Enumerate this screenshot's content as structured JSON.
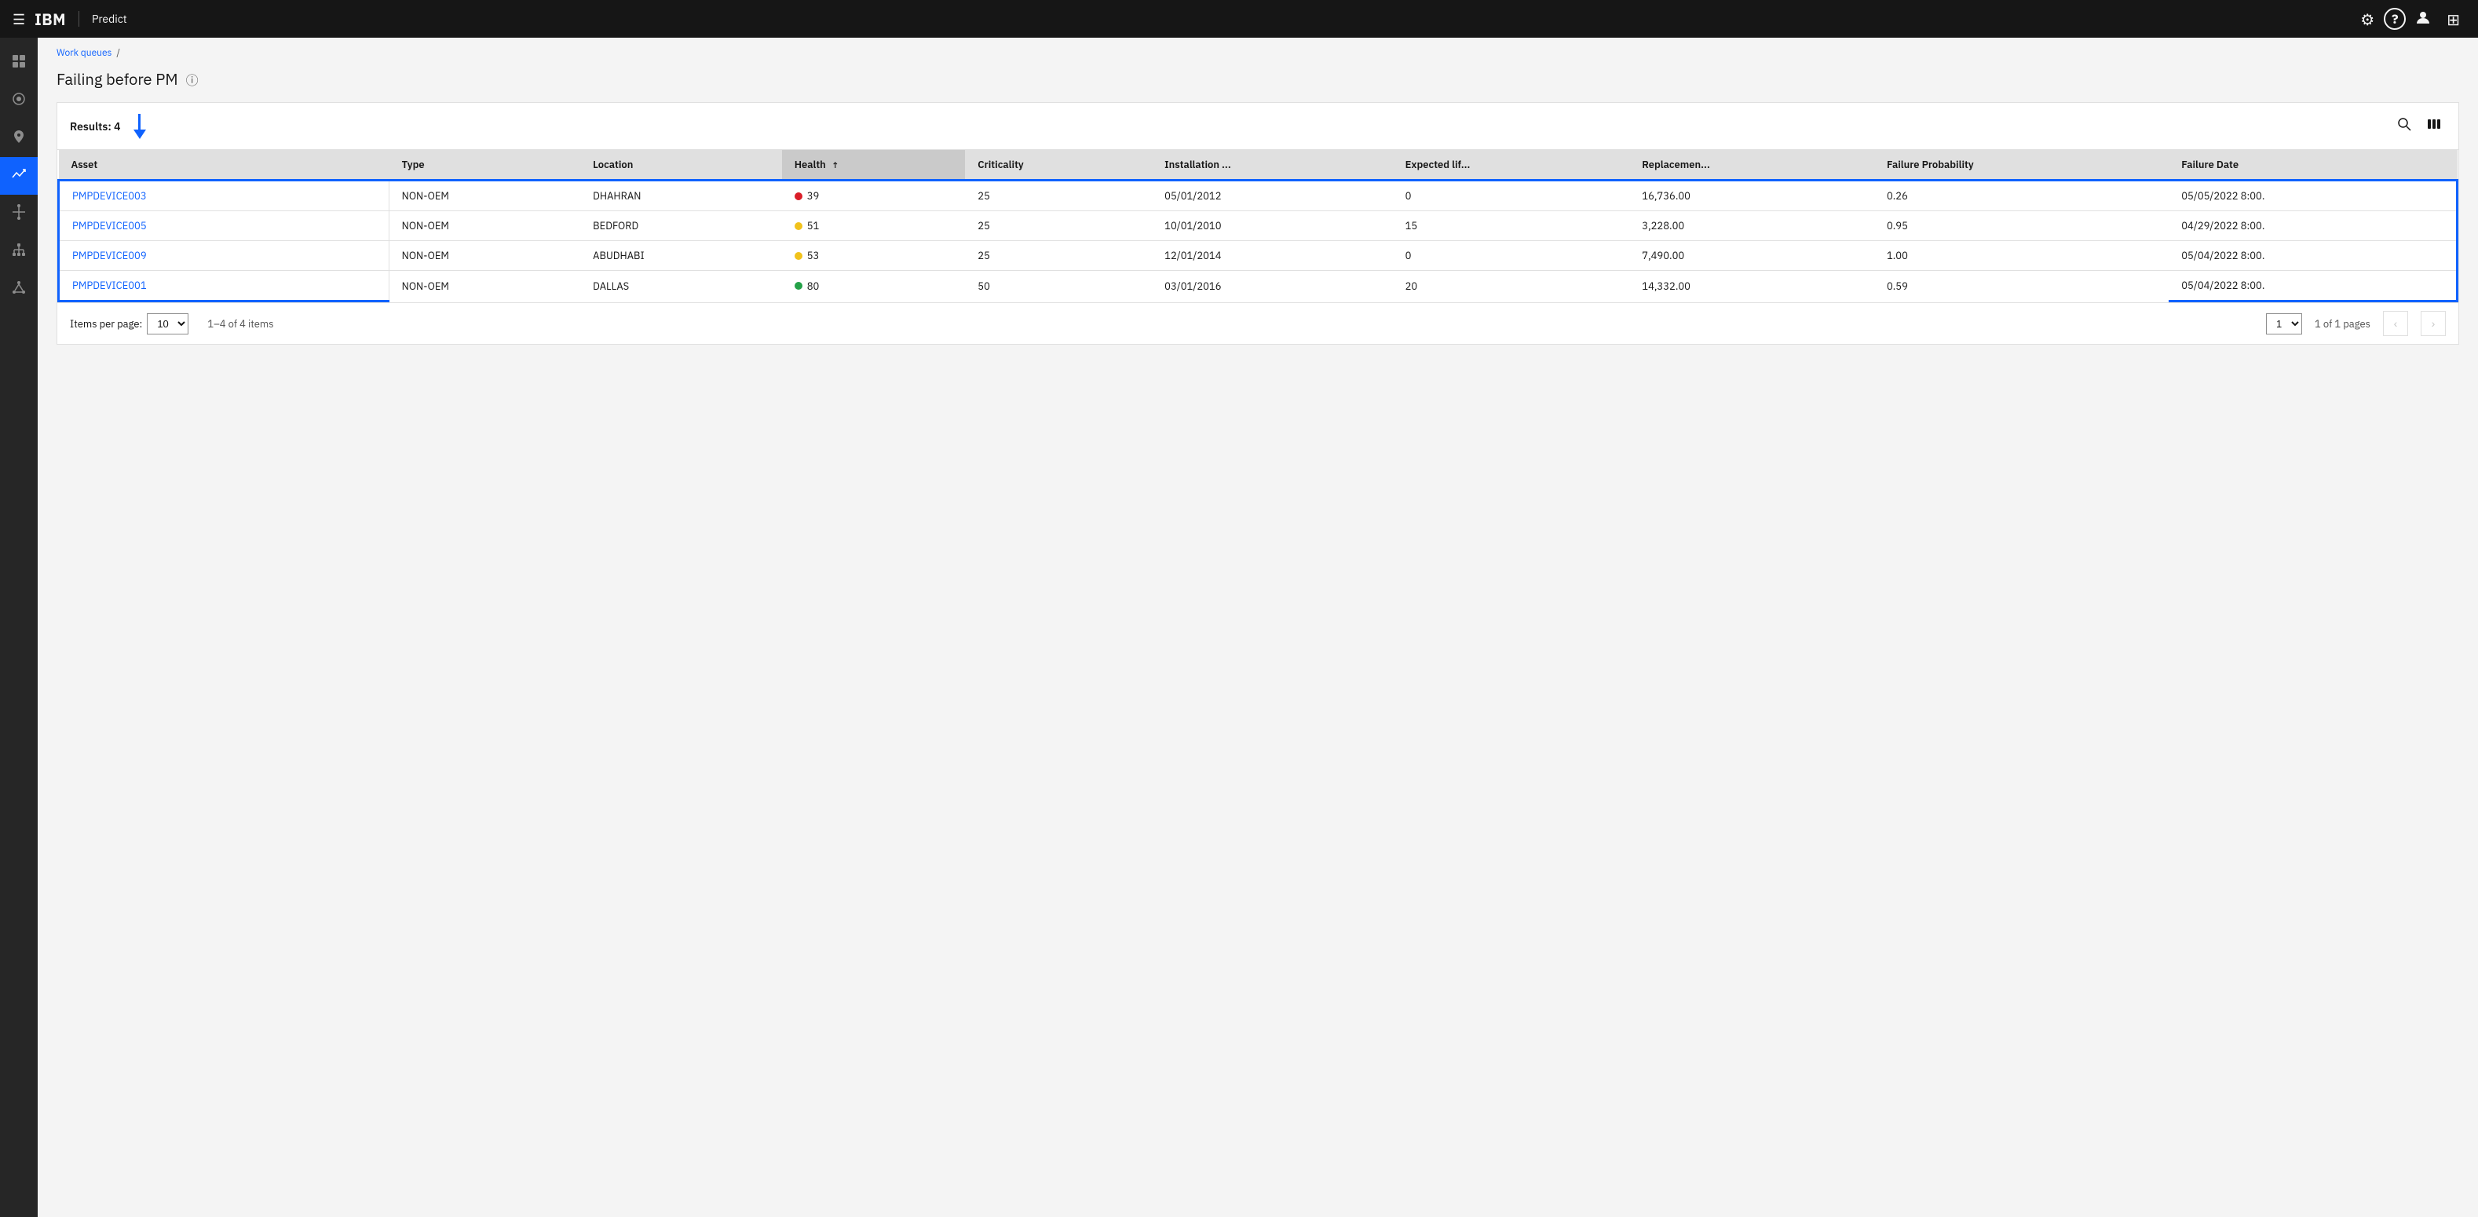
{
  "app": {
    "title": "Predict",
    "ibm_logo": "IBM"
  },
  "breadcrumb": {
    "parent_label": "Work queues",
    "separator": "/",
    "current": ""
  },
  "page": {
    "title": "Failing before PM",
    "info_icon": "ℹ"
  },
  "toolbar": {
    "results_label": "Results: 4",
    "search_icon": "🔍",
    "columns_icon": "⊞"
  },
  "table": {
    "columns": [
      {
        "id": "asset",
        "label": "Asset",
        "sorted": false
      },
      {
        "id": "type",
        "label": "Type",
        "sorted": false
      },
      {
        "id": "location",
        "label": "Location",
        "sorted": false
      },
      {
        "id": "health",
        "label": "Health",
        "sorted": true,
        "sort_dir": "asc"
      },
      {
        "id": "criticality",
        "label": "Criticality",
        "sorted": false
      },
      {
        "id": "installation",
        "label": "Installation ...",
        "sorted": false
      },
      {
        "id": "expected_life",
        "label": "Expected lif...",
        "sorted": false
      },
      {
        "id": "replacement",
        "label": "Replacemen...",
        "sorted": false
      },
      {
        "id": "failure_prob",
        "label": "Failure Probability",
        "sorted": false
      },
      {
        "id": "failure_date",
        "label": "Failure Date",
        "sorted": false
      }
    ],
    "rows": [
      {
        "asset": "PMPDEVICE003",
        "type": "NON-OEM",
        "location": "DHAHRAN",
        "health_value": "39",
        "health_color": "red",
        "criticality": "25",
        "installation_date": "05/01/2012",
        "expected_life": "0",
        "replacement_cost": "16,736.00",
        "failure_probability": "0.26",
        "failure_date": "05/05/2022 8:00.",
        "selected": true
      },
      {
        "asset": "PMPDEVICE005",
        "type": "NON-OEM",
        "location": "BEDFORD",
        "health_value": "51",
        "health_color": "yellow",
        "criticality": "25",
        "installation_date": "10/01/2010",
        "expected_life": "15",
        "replacement_cost": "3,228.00",
        "failure_probability": "0.95",
        "failure_date": "04/29/2022 8:00.",
        "selected": true
      },
      {
        "asset": "PMPDEVICE009",
        "type": "NON-OEM",
        "location": "ABUDHABI",
        "health_value": "53",
        "health_color": "yellow",
        "criticality": "25",
        "installation_date": "12/01/2014",
        "expected_life": "0",
        "replacement_cost": "7,490.00",
        "failure_probability": "1.00",
        "failure_date": "05/04/2022 8:00.",
        "selected": true
      },
      {
        "asset": "PMPDEVICE001",
        "type": "NON-OEM",
        "location": "DALLAS",
        "health_value": "80",
        "health_color": "green",
        "criticality": "50",
        "installation_date": "03/01/2016",
        "expected_life": "20",
        "replacement_cost": "14,332.00",
        "failure_probability": "0.59",
        "failure_date": "05/04/2022 8:00.",
        "selected": true
      }
    ]
  },
  "pagination": {
    "items_per_page_label": "Items per page:",
    "items_per_page_value": "10",
    "items_range": "1–4 of 4 items",
    "current_page": "1",
    "total_pages_label": "1 of 1 pages"
  },
  "sidebar": {
    "items": [
      {
        "icon": "☰",
        "name": "menu",
        "active": false
      },
      {
        "icon": "◎",
        "name": "home",
        "active": false
      },
      {
        "icon": "📍",
        "name": "location",
        "active": false
      },
      {
        "icon": "📈",
        "name": "analytics",
        "active": true
      },
      {
        "icon": "🔄",
        "name": "refresh",
        "active": false
      },
      {
        "icon": "👥",
        "name": "users",
        "active": false
      },
      {
        "icon": "⚡",
        "name": "alerts",
        "active": false
      }
    ]
  },
  "topnav_icons": {
    "settings": "⚙",
    "help": "?",
    "account": "👤",
    "apps": "⊞"
  }
}
